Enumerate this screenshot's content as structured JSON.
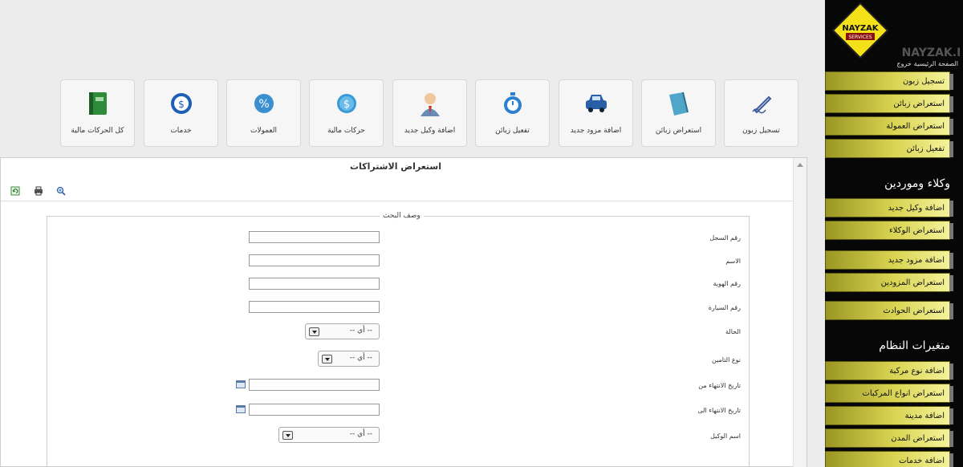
{
  "logo": {
    "badge_text": "NAYZAK",
    "sub_text": "SERVICES",
    "site_text": "NAYZAK.PS"
  },
  "top_links": {
    "home": "الصفحة الرئيسية",
    "logout": "خروج"
  },
  "sidebar": {
    "group1": [
      "تسجيل زبون",
      "استعراض زبائن",
      "استعراض العمولة",
      "تفعيل زبائن"
    ],
    "agents_heading": "وكلاء وموردين",
    "agents": [
      "اضافة وكيل جديد",
      "استعراض الوكلاء"
    ],
    "suppliers": [
      "اضافة مزود جديد",
      "استعراض المزودين"
    ],
    "accidents": [
      "استعراض الحوادث"
    ],
    "system_heading": "متغيرات النظام",
    "system": [
      "اضافة نوع مركبة",
      "استعراض انواع المركبات",
      "اضافة مدينة",
      "استعراض المدن",
      "اضافة خدمات"
    ]
  },
  "tiles": [
    {
      "label": "تسجيل زبون",
      "icon": "pen-signature-icon"
    },
    {
      "label": "استعراض زبائن",
      "icon": "book-icon"
    },
    {
      "label": "اضافة مزود جديد",
      "icon": "car-icon"
    },
    {
      "label": "تفعيل زبائن",
      "icon": "stopwatch-icon"
    },
    {
      "label": "اضافة وكيل جديد",
      "icon": "agent-person-icon"
    },
    {
      "label": "حركات مالية",
      "icon": "dollar-coin-icon"
    },
    {
      "label": "العمولات",
      "icon": "percent-icon"
    },
    {
      "label": "خدمات",
      "icon": "dollar-tag-icon"
    },
    {
      "label": "كل الحركات مالية",
      "icon": "ledger-icon"
    }
  ],
  "panel": {
    "title": "استعراض الاشتراكات",
    "toolbar": [
      "refresh-icon",
      "print-icon",
      "zoom-icon"
    ],
    "legend": "وصف البحث",
    "fields": {
      "record_no": "رقم السجل",
      "name": "الاسم",
      "id_no": "رقم الهوية",
      "car_no": "رقم السيارة",
      "status": "الحالة",
      "insurance_type": "نوع التامين",
      "expiry_from": "تاريخ الانتهاء من",
      "expiry_to": "تاريخ الانتهاء الى",
      "agent_name": "اسم الوكيل"
    },
    "select_default": "-- أي --"
  },
  "colors": {
    "sidebar_bg": "#070707",
    "button_yellow": "#d9d452",
    "page_bg": "#ececec"
  }
}
